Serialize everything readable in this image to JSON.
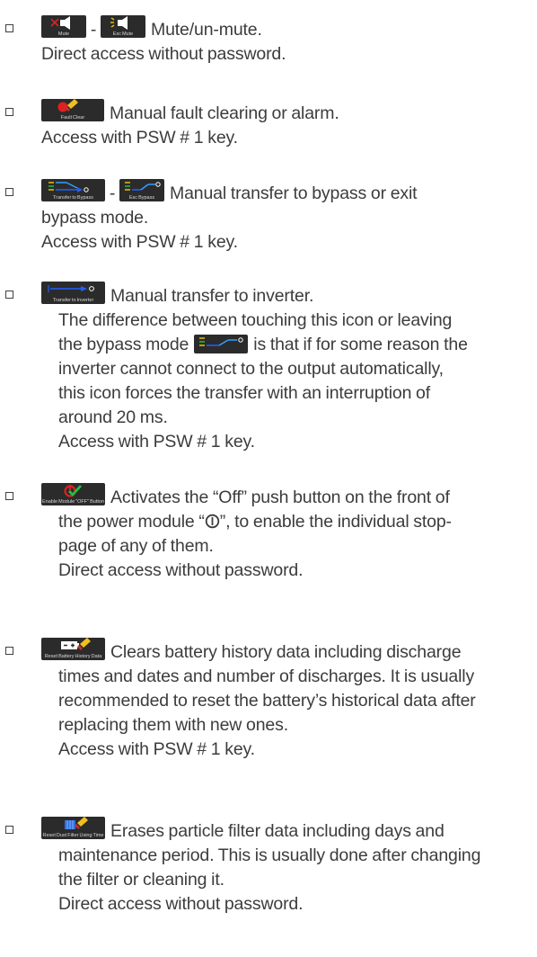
{
  "separator": "-",
  "entries": [
    {
      "icon_captions": [
        "Mute",
        "Esc Mute"
      ],
      "heading": "Mute/un-mute.",
      "lines": [
        "Direct access without password."
      ]
    },
    {
      "icon_captions": [
        "Fault Clear"
      ],
      "heading": "Manual fault clearing or alarm.",
      "lines": [
        "Access with PSW # 1 key."
      ]
    },
    {
      "icon_captions": [
        "Transfer to Bypass",
        "Esc Bypass"
      ],
      "heading": "Manual transfer to bypass or exit",
      "lines": [
        "bypass mode.",
        "Access with PSW # 1 key."
      ]
    },
    {
      "icon_captions": [
        "Transfer to Inverter"
      ],
      "heading": "Manual transfer to inverter.",
      "lines": [
        "The difference between touching this icon or leaving",
        "the bypass mode",
        "is that if for some reason the",
        "inverter cannot connect to the output automatically,",
        "this icon forces the transfer with an interruption of",
        "around 20 ms.",
        "Access with PSW # 1 key."
      ]
    },
    {
      "icon_captions": [
        "Enable Module \"OFF\" Button"
      ],
      "heading": "Activates the “Off” push button on the front of",
      "lines": [
        "the power module “",
        "”, to enable the individual stop-",
        "page of any of them.",
        "Direct access without password."
      ]
    },
    {
      "icon_captions": [
        "Reset Battery History Data"
      ],
      "heading": "Clears battery history data including discharge",
      "lines": [
        "times and dates and number of discharges. It is usually",
        "recommended to reset the battery’s historical data after",
        "replacing them with new ones.",
        "Access with PSW # 1 key."
      ]
    },
    {
      "icon_captions": [
        "Reset Dust Filter Using Time"
      ],
      "heading": "Erases particle filter data including days and",
      "lines": [
        "maintenance period. This is usually done after changing",
        "the filter or cleaning it.",
        "Direct access without password."
      ]
    }
  ]
}
